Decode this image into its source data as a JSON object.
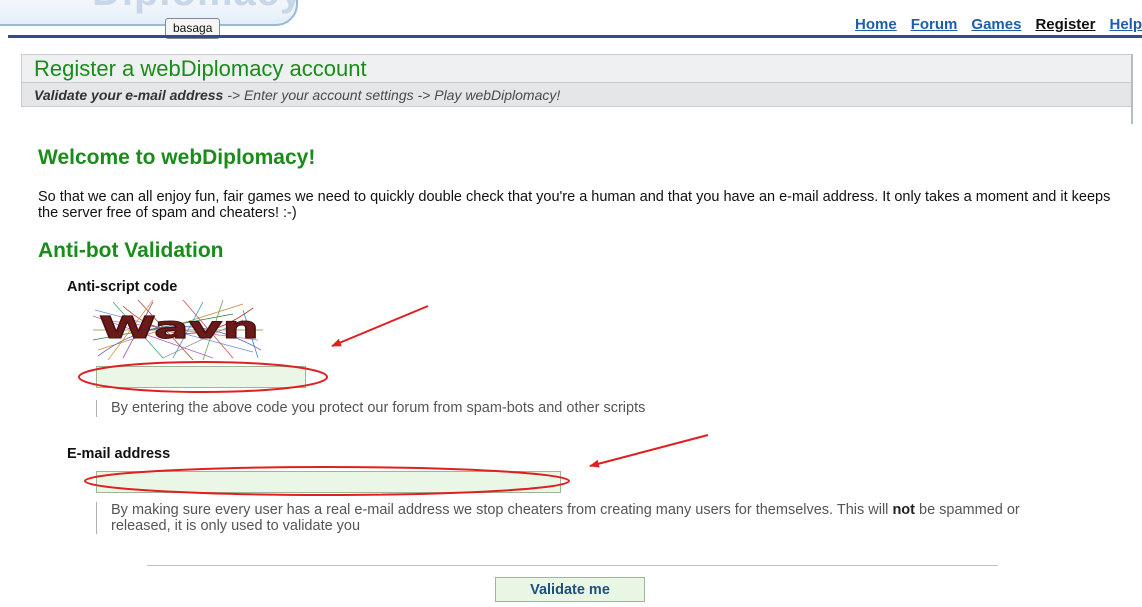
{
  "header": {
    "logo_text": "Diplomacy",
    "username": "basaga",
    "nav": [
      "Home",
      "Forum",
      "Games",
      "Register",
      "Help"
    ],
    "current_nav": "Register"
  },
  "page": {
    "title": "Register a webDiplomacy account",
    "steps": {
      "current": "Validate your e-mail address",
      "rest": " -> Enter your account settings -> Play webDiplomacy!"
    }
  },
  "welcome": {
    "heading": "Welcome to webDiplomacy!",
    "text": "So that we can all enjoy fun, fair games we need to quickly double check that you're a human and that you have an e-mail address. It only takes a moment and it keeps the server free of spam and cheaters! :-)"
  },
  "antibot": {
    "heading": "Anti-bot Validation",
    "captcha": {
      "label": "Anti-script code",
      "image_text": "Wavn",
      "value": "",
      "hint": "By entering the above code you protect our forum from spam-bots and other scripts"
    },
    "email": {
      "label": "E-mail address",
      "value": "",
      "hint_before": "By making sure every user has a real e-mail address we stop cheaters from creating many users for themselves. This will ",
      "hint_bold": "not",
      "hint_after": " be spammed or released, it is only used to validate you"
    }
  },
  "submit_label": "Validate me",
  "colors": {
    "heading_green": "#1a8c1a",
    "link_blue": "#1f5ea8",
    "input_bg": "#ebf7e6",
    "annotation_red": "#e02020"
  }
}
